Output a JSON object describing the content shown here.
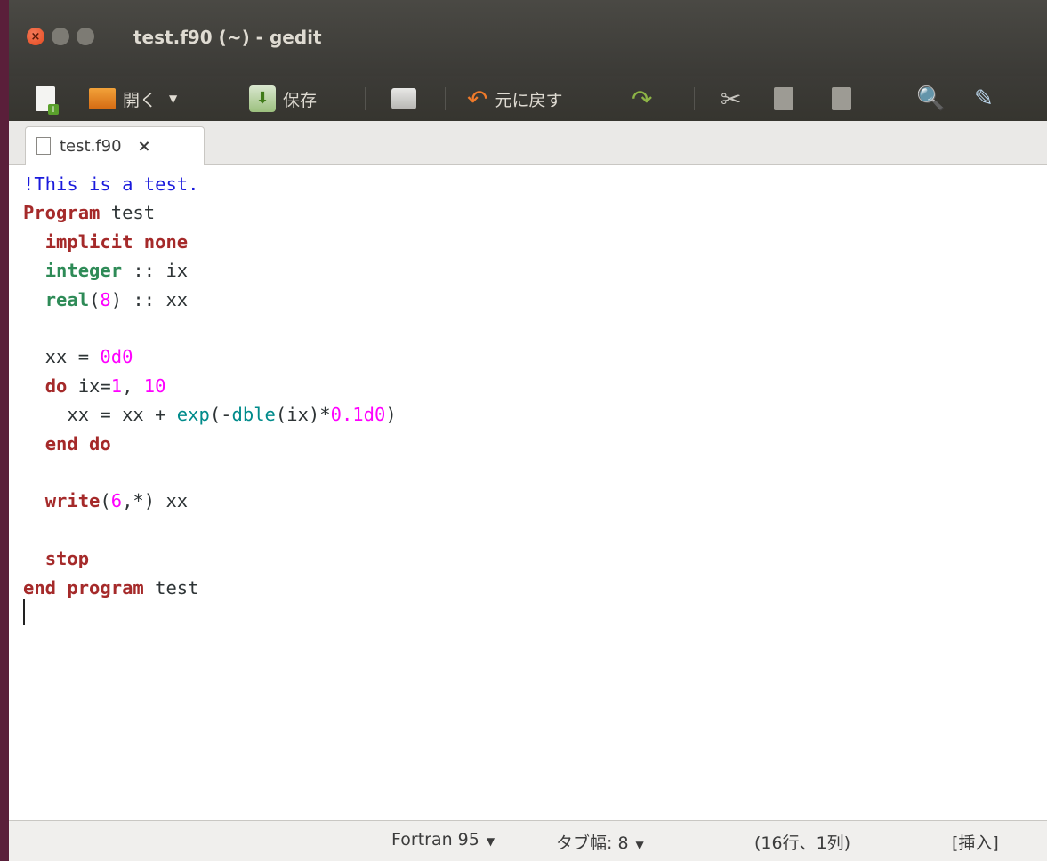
{
  "window": {
    "title": "test.f90 (~) - gedit"
  },
  "toolbar": {
    "open_label": "開く",
    "save_label": "保存",
    "undo_label": "元に戻す"
  },
  "tab": {
    "label": "test.f90",
    "close": "×"
  },
  "status": {
    "language": "Fortran 95",
    "tab_width": "タブ幅: 8",
    "position": "(16行、1列)",
    "mode": "[挿入]"
  },
  "code_lines": [
    "!This is a test.",
    "Program test",
    "  implicit none",
    "  integer :: ix",
    "  real(8) :: xx",
    "",
    "  xx = 0d0",
    "  do ix=1, 10",
    "    xx = xx + exp(-dble(ix)*0.1d0)",
    "  end do",
    "",
    "  write(6,*) xx",
    "",
    "  stop",
    "end program test",
    ""
  ],
  "colors": {
    "comment": "#1a1adc",
    "keyword": "#a52a2a",
    "type": "#2e8b57",
    "number": "#ff00ff",
    "function": "#008b8b"
  }
}
